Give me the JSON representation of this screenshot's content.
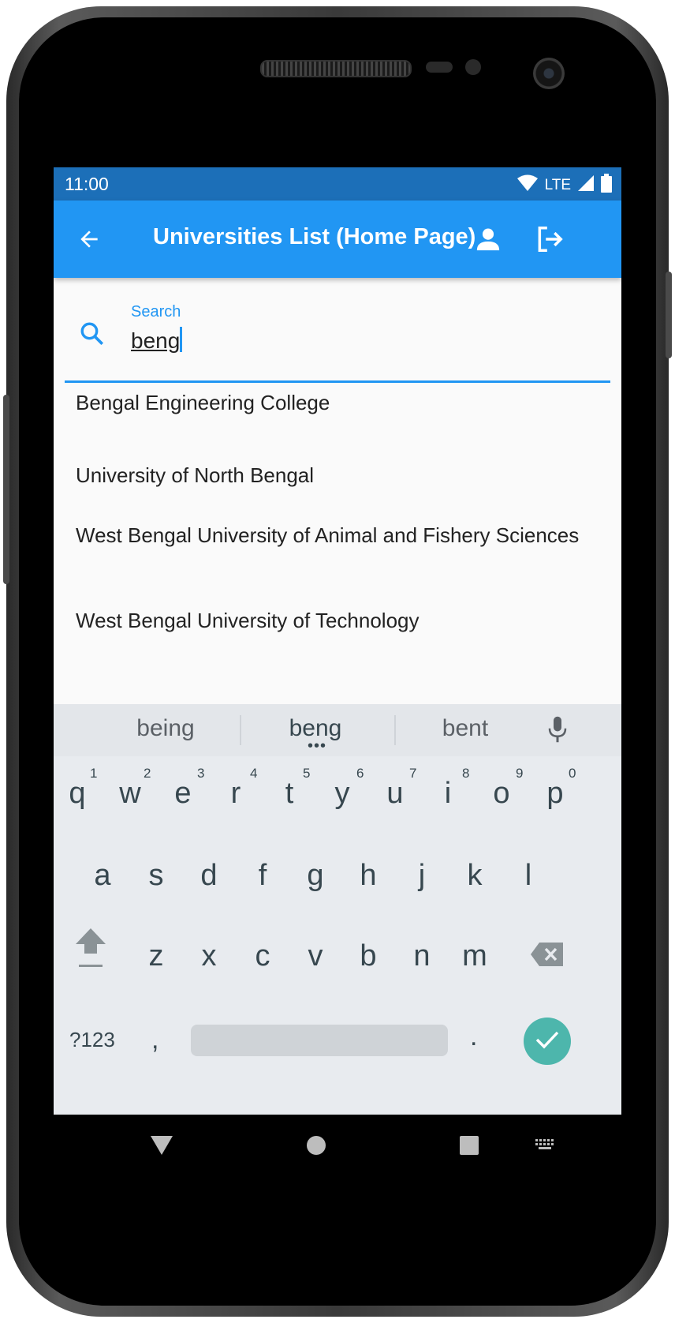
{
  "status_bar": {
    "time": "11:00",
    "network": "LTE"
  },
  "app_bar": {
    "title": "Universities List (Home Page)"
  },
  "search": {
    "label": "Search",
    "value": "beng"
  },
  "universities": [
    "Bengal Engineering College",
    "University of North Bengal",
    "West Bengal University of Animal and Fishery Sciences",
    "West Bengal University of Technology"
  ],
  "keyboard": {
    "suggestions": [
      "being",
      "beng",
      "bent"
    ],
    "row1": [
      "q",
      "w",
      "e",
      "r",
      "t",
      "y",
      "u",
      "i",
      "o",
      "p"
    ],
    "row1_numbers": [
      "1",
      "2",
      "3",
      "4",
      "5",
      "6",
      "7",
      "8",
      "9",
      "0"
    ],
    "row2": [
      "a",
      "s",
      "d",
      "f",
      "g",
      "h",
      "j",
      "k",
      "l"
    ],
    "row3": [
      "z",
      "x",
      "c",
      "v",
      "b",
      "n",
      "m"
    ],
    "symbols_label": "?123",
    "comma": ",",
    "period": "."
  },
  "colors": {
    "primary": "#2196f3",
    "status_bar": "#1c6fb8",
    "enter_key": "#4db6ac"
  },
  "icons": [
    "back-arrow-icon",
    "person-icon",
    "logout-icon",
    "search-icon",
    "mic-icon",
    "shift-icon",
    "backspace-icon",
    "check-icon",
    "nav-back-icon",
    "nav-home-icon",
    "nav-recents-icon",
    "keyboard-switch-icon"
  ]
}
